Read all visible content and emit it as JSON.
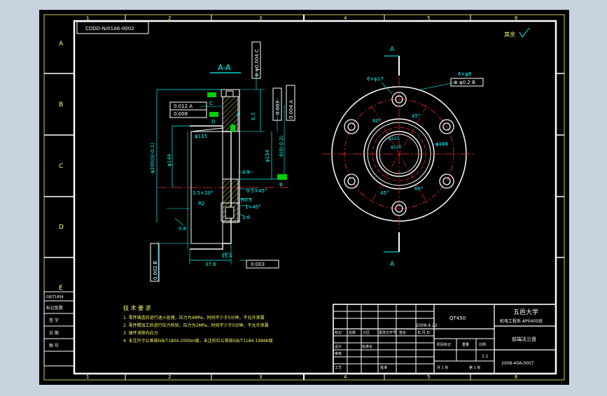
{
  "colors": {
    "background": "#c9d3e0",
    "paper": "#000000",
    "frame": "#ffffff",
    "zone_border": "#ffff66",
    "text": "#ffff66",
    "dimension": "#00ffff",
    "center_line": "#ff3030",
    "hatch": "#ffff66",
    "datum": "#00d000",
    "callout": "#ff66ff"
  },
  "zones": {
    "rows": [
      "A",
      "B",
      "C",
      "D",
      "E"
    ],
    "cols_top": [
      "1",
      "2",
      "3",
      "4",
      "5",
      "6"
    ],
    "cols_bottom": [
      "1",
      "2",
      "3",
      "4",
      "5",
      "6"
    ]
  },
  "header": {
    "drawing_code": "CDDD-N/01A6-0002",
    "roughness_label": "其余"
  },
  "section": {
    "title": "A-A",
    "dimensions": {
      "od": "φ200(0/-0.1)",
      "bore": "φ144",
      "hub": "φ154",
      "pilot": "φ115",
      "fillet": "R2",
      "chamfer": "1.5×20°",
      "groove": "0.5×45°",
      "corner": "R0.5",
      "chamfer2": "1×45°",
      "depth": "6.3",
      "height": "6(0/-0.2)",
      "step": "2.5",
      "length1": "35.4",
      "length2": "37.6",
      "tol_note": "0.8",
      "rough": "1.6"
    },
    "gdt": {
      "top_frame": "⊚ φ0.004 C",
      "flat1": "0.012 A",
      "flat2": "0.008",
      "perp": "0.003",
      "right_flat": "0.004 A",
      "bottom_left": "0.002 B",
      "bottom_right": "0.003"
    },
    "datums": [
      "C",
      "D",
      "A",
      "B"
    ]
  },
  "plan_view": {
    "cut_label_top": "A",
    "cut_label_bottom": "A",
    "holes_note": "6×φ17",
    "holes_note2": "6×φ8",
    "hole_frame": "⊕ φ0.2 B",
    "pcd": "φ193",
    "inner1": "φ125",
    "inner2": "φ120",
    "angle_45": "45°",
    "angle_60": "60°"
  },
  "tech_req": {
    "title": "技 术 要 求",
    "items": [
      "1. 零件铸造后进行退火处理，压力为4MPa，时间不少于5分钟，不允许渗漏",
      "2. 零件精加工后进行压力检验，压力为2MPa，时间不少于5分钟，不允许渗漏",
      "3. 铸件消除内应力",
      "4. 未注尺寸公差按GB/T1804-2000m级，未注形位公差按GB/T1184-1996K级"
    ]
  },
  "left_table": [
    "GB/T1804",
    "标记处数",
    "签 字",
    "日 期",
    "图 号"
  ],
  "title_block": {
    "material": "QT450",
    "school": "五邑大学",
    "dept": "机电工程系 AP0405班",
    "part_name": "前端法兰盘",
    "drawing_no": "2008-40A-0007",
    "date": "2008.4.22",
    "scale": "1:1",
    "rows": [
      "标记",
      "处数",
      "分区",
      "更改文件号",
      "签名",
      "年.月.日"
    ],
    "designer_label": "设计",
    "review_label": "审核",
    "process_label": "工艺",
    "approve_label": "批准",
    "std_label": "标准化",
    "stage_label": "阶段标记",
    "weight_label": "重量",
    "scale_label": "比例",
    "sheet_label": "共 1 张",
    "sheet_of": "第 1 张"
  }
}
